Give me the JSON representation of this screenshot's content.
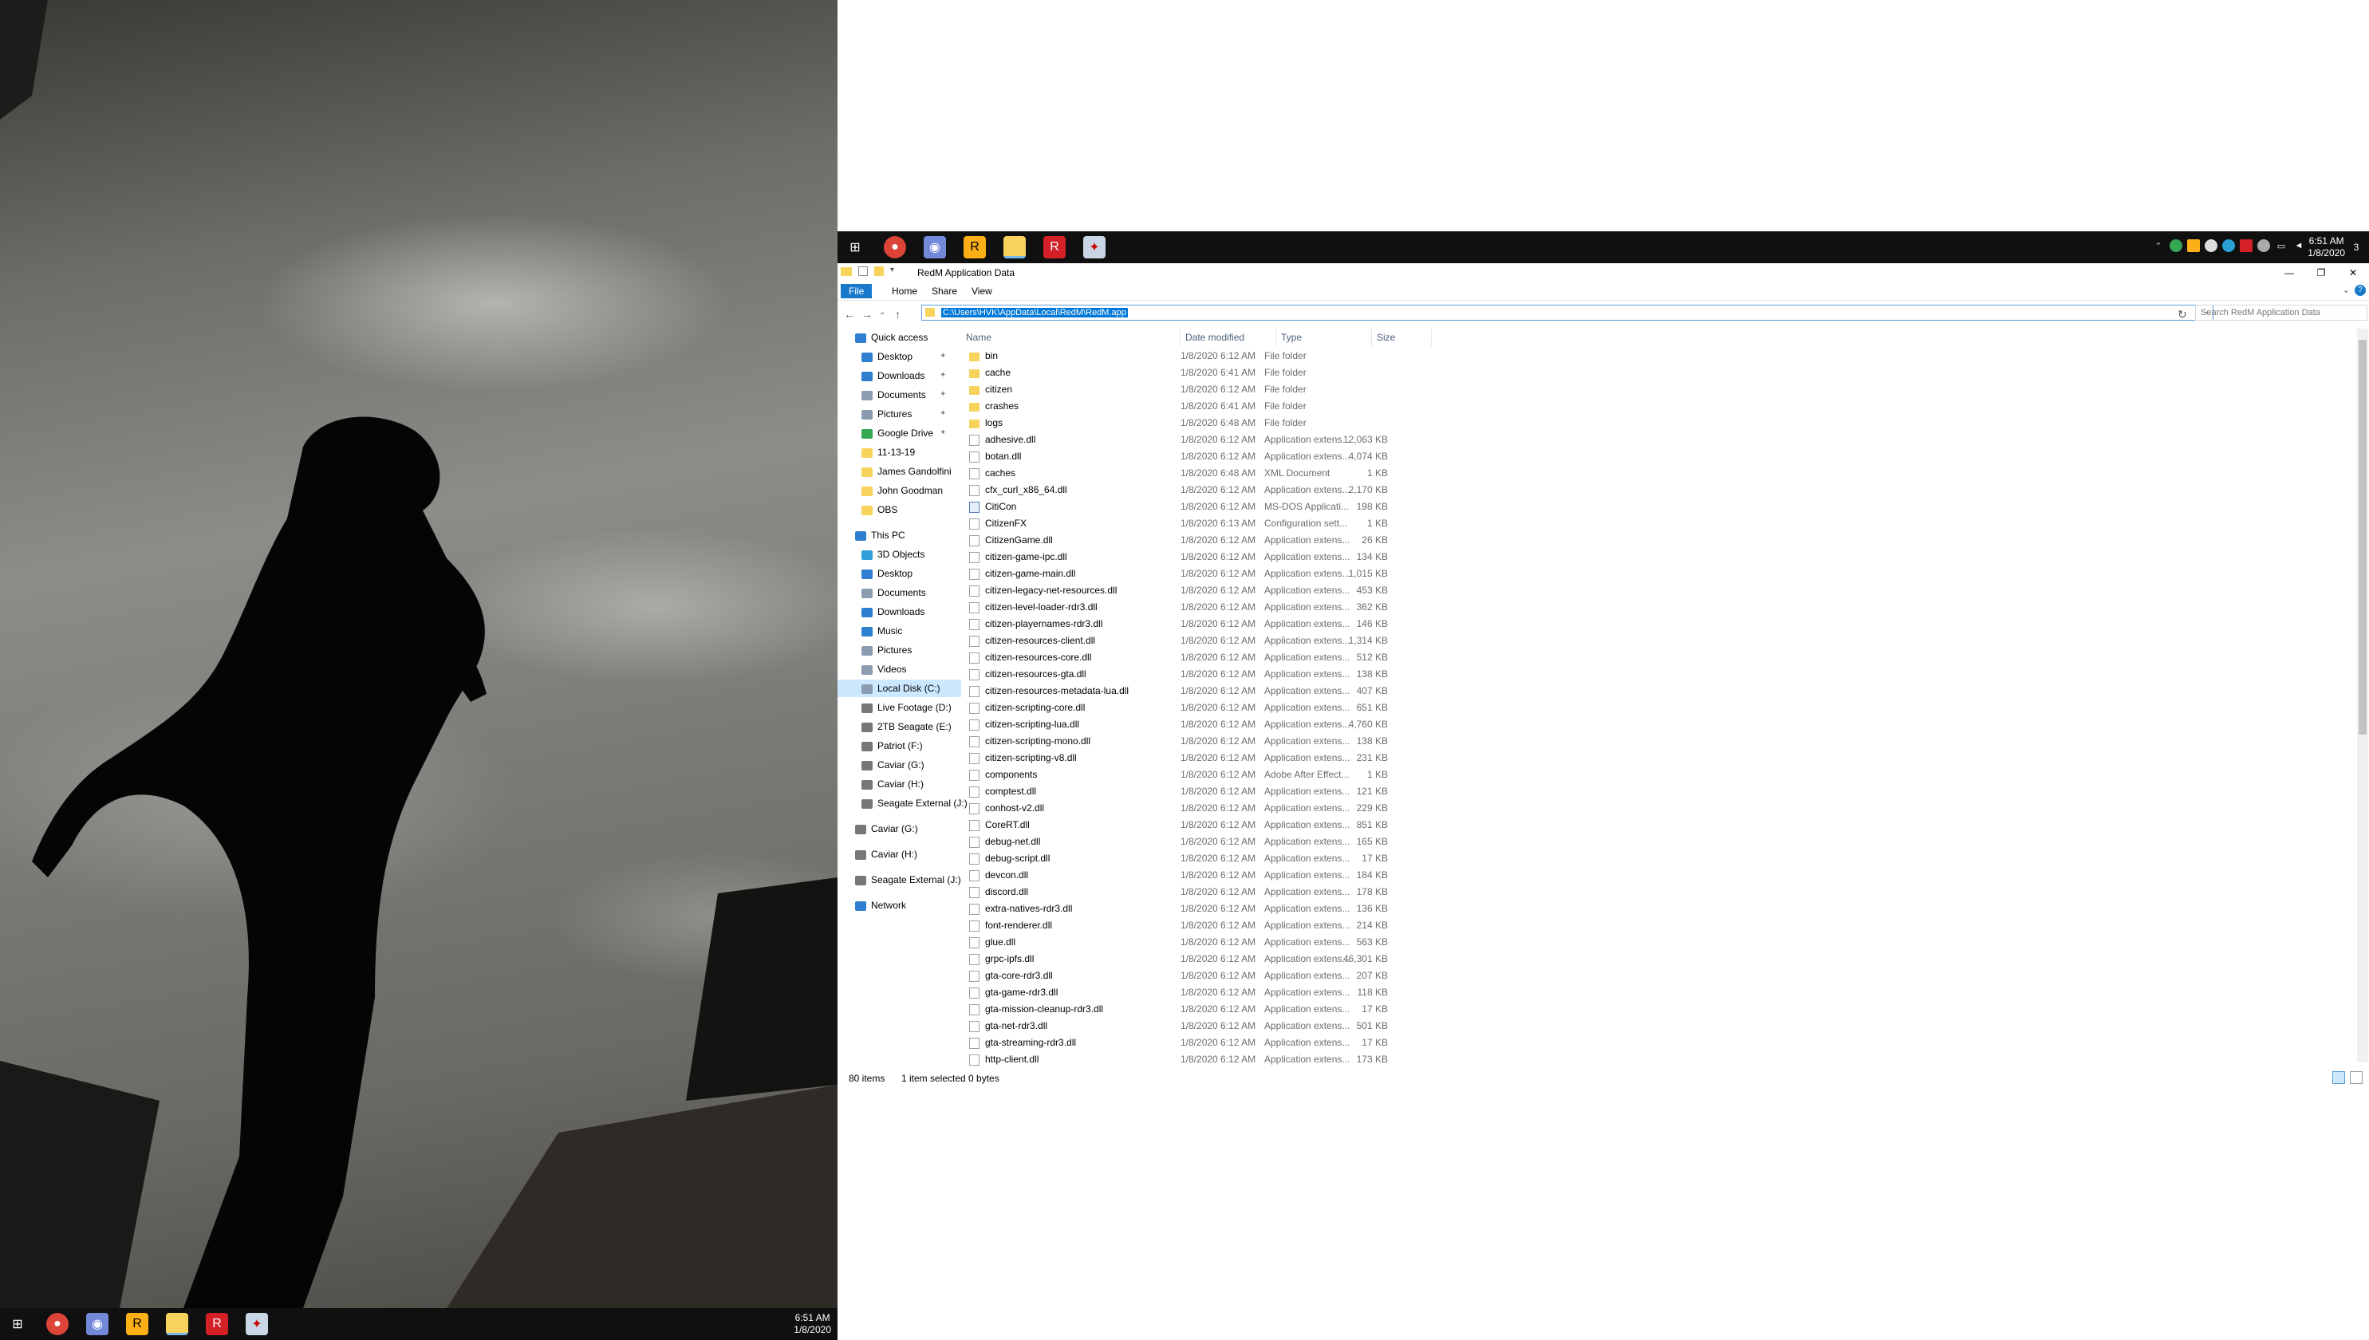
{
  "left_taskbar": {
    "icons": [
      "windows-icon",
      "chrome-icon",
      "discord-icon",
      "rockstar-icon",
      "file-explorer-icon",
      "redm-icon",
      "steam-game-icon"
    ],
    "time": "6:51 AM",
    "date": "1/8/2020"
  },
  "right_taskbar": {
    "icons": [
      "windows-icon",
      "chrome-icon",
      "discord-icon",
      "rockstar-icon",
      "file-explorer-icon",
      "redm-icon",
      "steam-game-icon"
    ],
    "time": "6:51 AM",
    "date": "1/8/2020",
    "notification_count": "3"
  },
  "explorer": {
    "title": "RedM Application Data",
    "tabs": {
      "file": "File",
      "home": "Home",
      "share": "Share",
      "view": "View"
    },
    "address": "C:\\Users\\HVK\\AppData\\Local\\RedM\\RedM.app",
    "search_placeholder": "Search RedM Application Data",
    "columns": {
      "name": "Name",
      "date": "Date modified",
      "type": "Type",
      "size": "Size"
    },
    "nav": {
      "quick_access": "Quick access",
      "quick": [
        {
          "label": "Desktop",
          "pinned": true,
          "color": "#2f7fd1"
        },
        {
          "label": "Downloads",
          "pinned": true,
          "color": "#2f7fd1"
        },
        {
          "label": "Documents",
          "pinned": true,
          "color": "#8b9bb0"
        },
        {
          "label": "Pictures",
          "pinned": true,
          "color": "#8b9bb0"
        },
        {
          "label": "Google Drive",
          "pinned": true,
          "color": "#34a853"
        },
        {
          "label": "11-13-19",
          "pinned": false,
          "color": "#f7d35b"
        },
        {
          "label": "James Gandolfini",
          "pinned": false,
          "color": "#f7d35b"
        },
        {
          "label": "John Goodman",
          "pinned": false,
          "color": "#f7d35b"
        },
        {
          "label": "OBS",
          "pinned": false,
          "color": "#f7d35b"
        }
      ],
      "this_pc": "This PC",
      "pc": [
        {
          "label": "3D Objects",
          "color": "#2fa0d8"
        },
        {
          "label": "Desktop",
          "color": "#2f7fd1"
        },
        {
          "label": "Documents",
          "color": "#8b9bb0"
        },
        {
          "label": "Downloads",
          "color": "#2f7fd1"
        },
        {
          "label": "Music",
          "color": "#2f7fd1"
        },
        {
          "label": "Pictures",
          "color": "#8b9bb0"
        },
        {
          "label": "Videos",
          "color": "#8b9bb0"
        },
        {
          "label": "Local Disk (C:)",
          "color": "#8b9bb0"
        },
        {
          "label": "Live Footage  (D:)",
          "color": "#777777"
        },
        {
          "label": "2TB Seagate (E:)",
          "color": "#777777"
        },
        {
          "label": "Patriot (F:)",
          "color": "#777777"
        },
        {
          "label": "Caviar (G:)",
          "color": "#777777"
        },
        {
          "label": "Caviar (H:)",
          "color": "#777777"
        },
        {
          "label": "Seagate External (J:)",
          "color": "#777777"
        }
      ],
      "drives": [
        "Caviar (G:)",
        "Caviar (H:)",
        "Seagate External (J:)"
      ],
      "network": "Network"
    },
    "files": [
      {
        "name": "bin",
        "date": "1/8/2020 6:12 AM",
        "type": "File folder",
        "size": "",
        "kind": "folder"
      },
      {
        "name": "cache",
        "date": "1/8/2020 6:41 AM",
        "type": "File folder",
        "size": "",
        "kind": "folder"
      },
      {
        "name": "citizen",
        "date": "1/8/2020 6:12 AM",
        "type": "File folder",
        "size": "",
        "kind": "folder"
      },
      {
        "name": "crashes",
        "date": "1/8/2020 6:41 AM",
        "type": "File folder",
        "size": "",
        "kind": "folder"
      },
      {
        "name": "logs",
        "date": "1/8/2020 6:48 AM",
        "type": "File folder",
        "size": "",
        "kind": "folder"
      },
      {
        "name": "adhesive.dll",
        "date": "1/8/2020 6:12 AM",
        "type": "Application extens...",
        "size": "12,063 KB",
        "kind": "file"
      },
      {
        "name": "botan.dll",
        "date": "1/8/2020 6:12 AM",
        "type": "Application extens...",
        "size": "4,074 KB",
        "kind": "file"
      },
      {
        "name": "caches",
        "date": "1/8/2020 6:48 AM",
        "type": "XML Document",
        "size": "1 KB",
        "kind": "file"
      },
      {
        "name": "cfx_curl_x86_64.dll",
        "date": "1/8/2020 6:12 AM",
        "type": "Application extens...",
        "size": "2,170 KB",
        "kind": "file"
      },
      {
        "name": "CitiCon",
        "date": "1/8/2020 6:12 AM",
        "type": "MS-DOS Applicati...",
        "size": "198 KB",
        "kind": "exe"
      },
      {
        "name": "CitizenFX",
        "date": "1/8/2020 6:13 AM",
        "type": "Configuration sett...",
        "size": "1 KB",
        "kind": "file"
      },
      {
        "name": "CitizenGame.dll",
        "date": "1/8/2020 6:12 AM",
        "type": "Application extens...",
        "size": "26 KB",
        "kind": "file"
      },
      {
        "name": "citizen-game-ipc.dll",
        "date": "1/8/2020 6:12 AM",
        "type": "Application extens...",
        "size": "134 KB",
        "kind": "file"
      },
      {
        "name": "citizen-game-main.dll",
        "date": "1/8/2020 6:12 AM",
        "type": "Application extens...",
        "size": "1,015 KB",
        "kind": "file"
      },
      {
        "name": "citizen-legacy-net-resources.dll",
        "date": "1/8/2020 6:12 AM",
        "type": "Application extens...",
        "size": "453 KB",
        "kind": "file"
      },
      {
        "name": "citizen-level-loader-rdr3.dll",
        "date": "1/8/2020 6:12 AM",
        "type": "Application extens...",
        "size": "362 KB",
        "kind": "file"
      },
      {
        "name": "citizen-playernames-rdr3.dll",
        "date": "1/8/2020 6:12 AM",
        "type": "Application extens...",
        "size": "146 KB",
        "kind": "file"
      },
      {
        "name": "citizen-resources-client.dll",
        "date": "1/8/2020 6:12 AM",
        "type": "Application extens...",
        "size": "1,314 KB",
        "kind": "file"
      },
      {
        "name": "citizen-resources-core.dll",
        "date": "1/8/2020 6:12 AM",
        "type": "Application extens...",
        "size": "512 KB",
        "kind": "file"
      },
      {
        "name": "citizen-resources-gta.dll",
        "date": "1/8/2020 6:12 AM",
        "type": "Application extens...",
        "size": "138 KB",
        "kind": "file"
      },
      {
        "name": "citizen-resources-metadata-lua.dll",
        "date": "1/8/2020 6:12 AM",
        "type": "Application extens...",
        "size": "407 KB",
        "kind": "file"
      },
      {
        "name": "citizen-scripting-core.dll",
        "date": "1/8/2020 6:12 AM",
        "type": "Application extens...",
        "size": "651 KB",
        "kind": "file"
      },
      {
        "name": "citizen-scripting-lua.dll",
        "date": "1/8/2020 6:12 AM",
        "type": "Application extens...",
        "size": "4,760 KB",
        "kind": "file"
      },
      {
        "name": "citizen-scripting-mono.dll",
        "date": "1/8/2020 6:12 AM",
        "type": "Application extens...",
        "size": "138 KB",
        "kind": "file"
      },
      {
        "name": "citizen-scripting-v8.dll",
        "date": "1/8/2020 6:12 AM",
        "type": "Application extens...",
        "size": "231 KB",
        "kind": "file"
      },
      {
        "name": "components",
        "date": "1/8/2020 6:12 AM",
        "type": "Adobe After Effect...",
        "size": "1 KB",
        "kind": "file"
      },
      {
        "name": "comptest.dll",
        "date": "1/8/2020 6:12 AM",
        "type": "Application extens...",
        "size": "121 KB",
        "kind": "file"
      },
      {
        "name": "conhost-v2.dll",
        "date": "1/8/2020 6:12 AM",
        "type": "Application extens...",
        "size": "229 KB",
        "kind": "file"
      },
      {
        "name": "CoreRT.dll",
        "date": "1/8/2020 6:12 AM",
        "type": "Application extens...",
        "size": "851 KB",
        "kind": "file"
      },
      {
        "name": "debug-net.dll",
        "date": "1/8/2020 6:12 AM",
        "type": "Application extens...",
        "size": "165 KB",
        "kind": "file"
      },
      {
        "name": "debug-script.dll",
        "date": "1/8/2020 6:12 AM",
        "type": "Application extens...",
        "size": "17 KB",
        "kind": "file"
      },
      {
        "name": "devcon.dll",
        "date": "1/8/2020 6:12 AM",
        "type": "Application extens...",
        "size": "184 KB",
        "kind": "file"
      },
      {
        "name": "discord.dll",
        "date": "1/8/2020 6:12 AM",
        "type": "Application extens...",
        "size": "178 KB",
        "kind": "file"
      },
      {
        "name": "extra-natives-rdr3.dll",
        "date": "1/8/2020 6:12 AM",
        "type": "Application extens...",
        "size": "136 KB",
        "kind": "file"
      },
      {
        "name": "font-renderer.dll",
        "date": "1/8/2020 6:12 AM",
        "type": "Application extens...",
        "size": "214 KB",
        "kind": "file"
      },
      {
        "name": "glue.dll",
        "date": "1/8/2020 6:12 AM",
        "type": "Application extens...",
        "size": "563 KB",
        "kind": "file"
      },
      {
        "name": "grpc-ipfs.dll",
        "date": "1/8/2020 6:12 AM",
        "type": "Application extens...",
        "size": "46,301 KB",
        "kind": "file"
      },
      {
        "name": "gta-core-rdr3.dll",
        "date": "1/8/2020 6:12 AM",
        "type": "Application extens...",
        "size": "207 KB",
        "kind": "file"
      },
      {
        "name": "gta-game-rdr3.dll",
        "date": "1/8/2020 6:12 AM",
        "type": "Application extens...",
        "size": "118 KB",
        "kind": "file"
      },
      {
        "name": "gta-mission-cleanup-rdr3.dll",
        "date": "1/8/2020 6:12 AM",
        "type": "Application extens...",
        "size": "17 KB",
        "kind": "file"
      },
      {
        "name": "gta-net-rdr3.dll",
        "date": "1/8/2020 6:12 AM",
        "type": "Application extens...",
        "size": "501 KB",
        "kind": "file"
      },
      {
        "name": "gta-streaming-rdr3.dll",
        "date": "1/8/2020 6:12 AM",
        "type": "Application extens...",
        "size": "17 KB",
        "kind": "file"
      },
      {
        "name": "http-client.dll",
        "date": "1/8/2020 6:12 AM",
        "type": "Application extens...",
        "size": "173 KB",
        "kind": "file"
      }
    ],
    "status": {
      "count": "80 items",
      "selection": "1 item selected  0 bytes"
    }
  }
}
